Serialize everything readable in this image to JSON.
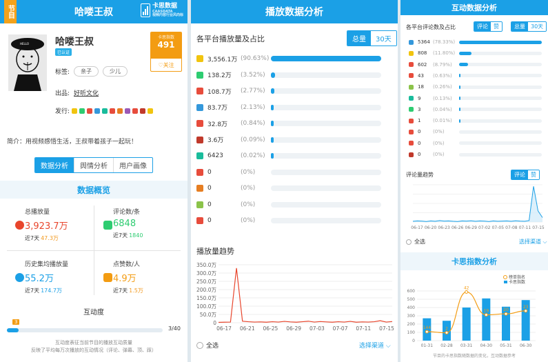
{
  "left": {
    "corner_tag": "节目",
    "header_title": "哈喽王叔",
    "logo": {
      "name": "卡思数据",
      "slogan": "CAASDATA",
      "tagline": "视频内容行业风向标"
    },
    "profile": {
      "name": "哈喽王叔",
      "verified_badge": "已认证",
      "avatar_text": "HELLO",
      "labels_caption": "标签:",
      "labels": [
        "亲子",
        "少儿"
      ],
      "producer_caption": "出品:",
      "producer": "好听文化",
      "platforms_caption": "发行:",
      "platform_colors": [
        "#f1c40f",
        "#2ecc71",
        "#e74c3c",
        "#3498db",
        "#1abc9c",
        "#e74c3c",
        "#e67e22",
        "#9b59b6",
        "#e74c3c",
        "#c0392b",
        "#f1c40f"
      ]
    },
    "rank": {
      "label": "卡思指数",
      "value": "491",
      "follow": "♡关注"
    },
    "intro": "简介：用视频感悟生活，王叔带着孩子一起玩！",
    "tabs": [
      "数据分析",
      "舆情分析",
      "用户画像"
    ],
    "overview_title": "数据概览",
    "stats": [
      {
        "label": "总播放量",
        "value": "3,923.7万",
        "sub_label": "近7天",
        "sub_value": "47.3万",
        "icon": "play-icon",
        "color": "#e8452c"
      },
      {
        "label": "评论数/条",
        "value": "6848",
        "sub_label": "近7天",
        "sub_value": "1840",
        "icon": "comment-icon",
        "color": "#2ecc71"
      },
      {
        "label": "历史集均播放量",
        "value": "55.2万",
        "sub_label": "近7天",
        "sub_value": "174.7万",
        "icon": "clock-icon",
        "color": "#1ba0e6"
      },
      {
        "label": "点赞数/人",
        "value": "4.9万",
        "sub_label": "近7天",
        "sub_value": "1.5万",
        "icon": "thumb-icon",
        "color": "#f39c12"
      }
    ],
    "interaction": {
      "title": "互动度",
      "badge": "3",
      "count": "3",
      "total": "/40",
      "progress": 0.075,
      "note1": "互动度表征当前节目的播放互动质量",
      "note2": "反映了平均每万次播放的互动情况（评论、弹幕、顶、踩）"
    }
  },
  "middle": {
    "header_title": "播放数据分析",
    "section_title": "各平台播放量及占比",
    "toggle": [
      "总量",
      "30天"
    ],
    "platforms": [
      {
        "value": "3,556.1万",
        "pct": "(90.63%)",
        "ratio": 0.9063,
        "color": "#f1c40f",
        "icon": "youku-icon"
      },
      {
        "value": "138.2万",
        "pct": "(3.52%)",
        "ratio": 0.0352,
        "color": "#2ecc71",
        "icon": "iqiyi-icon"
      },
      {
        "value": "108.7万",
        "pct": "(2.77%)",
        "ratio": 0.0277,
        "color": "#e74c3c",
        "icon": "tencent-icon"
      },
      {
        "value": "83.7万",
        "pct": "(2.13%)",
        "ratio": 0.0213,
        "color": "#3498db",
        "icon": "bilibili-icon"
      },
      {
        "value": "32.8万",
        "pct": "(0.84%)",
        "ratio": 0.0084,
        "color": "#e74c3c",
        "icon": "weibo-icon"
      },
      {
        "value": "3.6万",
        "pct": "(0.09%)",
        "ratio": 0.0009,
        "color": "#c0392b",
        "icon": "toutiao-icon"
      },
      {
        "value": "6423",
        "pct": "(0.02%)",
        "ratio": 0.0002,
        "color": "#1abc9c",
        "icon": "sohu-icon"
      },
      {
        "value": "0",
        "pct": "(0%)",
        "ratio": 0,
        "color": "#e74c3c",
        "icon": "meipai-icon"
      },
      {
        "value": "0",
        "pct": "(0%)",
        "ratio": 0,
        "color": "#e67e22",
        "icon": "miaopai-icon"
      },
      {
        "value": "0",
        "pct": "(0%)",
        "ratio": 0,
        "color": "#8bc34a",
        "icon": "acfun-icon"
      },
      {
        "value": "0",
        "pct": "(0%)",
        "ratio": 0,
        "color": "#e74c3c",
        "icon": "le-icon"
      }
    ],
    "trend_title": "播放量趋势",
    "select_all": "全选",
    "choose_channel": "选择渠道 ⌵"
  },
  "right": {
    "header_title": "互动数据分析",
    "section_title": "各平台评论数及占比",
    "toggle_a": [
      "评论",
      "赞"
    ],
    "toggle_b": [
      "总量",
      "30天"
    ],
    "platforms": [
      {
        "value": "5364",
        "pct": "(78.33%)",
        "ratio": 0.7833,
        "color": "#3498db"
      },
      {
        "value": "808",
        "pct": "(11.80%)",
        "ratio": 0.118,
        "color": "#f1c40f"
      },
      {
        "value": "602",
        "pct": "(8.79%)",
        "ratio": 0.0879,
        "color": "#e74c3c"
      },
      {
        "value": "43",
        "pct": "(0.63%)",
        "ratio": 0.0063,
        "color": "#e74c3c"
      },
      {
        "value": "18",
        "pct": "(0.26%)",
        "ratio": 0.0026,
        "color": "#8bc34a"
      },
      {
        "value": "9",
        "pct": "(0.13%)",
        "ratio": 0.0013,
        "color": "#1abc9c"
      },
      {
        "value": "3",
        "pct": "(0.04%)",
        "ratio": 0.0004,
        "color": "#2ecc71"
      },
      {
        "value": "1",
        "pct": "(0.01%)",
        "ratio": 0.0001,
        "color": "#e74c3c"
      },
      {
        "value": "0",
        "pct": "(0%)",
        "ratio": 0,
        "color": "#e74c3c"
      },
      {
        "value": "0",
        "pct": "(0%)",
        "ratio": 0,
        "color": "#e74c3c"
      },
      {
        "value": "0",
        "pct": "(0%)",
        "ratio": 0,
        "color": "#c0392b"
      }
    ],
    "comment_trend_title": "评论量趋势",
    "toggle_c": [
      "评论",
      "赞"
    ],
    "select_all": "全选",
    "choose_channel": "选择渠道 ⌵",
    "index_title": "卡思指数分析",
    "legend": [
      "榜单指名",
      "卡思指数"
    ],
    "footer_note": "节目的卡思指数随数据的变化，互动数据参考"
  },
  "chart_data": [
    {
      "type": "line",
      "x": [
        "06-17",
        "06-21",
        "06-25",
        "06-29",
        "07-03",
        "07-07",
        "07-11",
        "07-15"
      ],
      "y_ticks": [
        "0",
        "50.0万",
        "100.0万",
        "150.0万",
        "200.0万",
        "250.0万",
        "300.0万",
        "350.0万"
      ],
      "ylim": [
        0,
        3500000
      ],
      "series": [
        {
          "values": [
            20000,
            30000,
            40000,
            3300000,
            90000,
            60000,
            40000,
            50000,
            30000,
            60000,
            40000,
            80000,
            50000,
            30000,
            60000,
            90000,
            40000,
            70000,
            50000,
            30000,
            60000,
            40000,
            80000,
            30000,
            50000,
            40000,
            60000,
            120000,
            40000,
            70000
          ]
        }
      ]
    },
    {
      "type": "line",
      "x": [
        "06-17",
        "06-20",
        "06-23",
        "06-26",
        "06-29",
        "07-02",
        "07-05",
        "07-08",
        "07-11",
        "07-15"
      ],
      "ylim": [
        0,
        1000
      ],
      "series": [
        {
          "values": [
            20,
            30,
            25,
            15,
            30,
            20,
            40,
            25,
            30,
            20,
            15,
            30,
            25,
            35,
            20,
            30,
            25,
            15,
            30,
            20,
            25,
            30,
            20,
            35,
            25,
            20,
            40,
            960,
            300,
            120
          ]
        }
      ]
    },
    {
      "type": "bar",
      "categories": [
        "01-31",
        "02-28",
        "03-31",
        "04-30",
        "05-31",
        "06-30"
      ],
      "values": [
        270,
        240,
        400,
        510,
        410,
        490
      ],
      "ylim": [
        0,
        600
      ],
      "y_ticks": [
        "0",
        "100",
        "200",
        "300",
        "400",
        "500",
        "600"
      ],
      "line_values": [
        2,
        1,
        42,
        19,
        20,
        23
      ],
      "line_labels": [
        "144",
        "2",
        "42",
        "19",
        "20",
        "23"
      ]
    }
  ]
}
